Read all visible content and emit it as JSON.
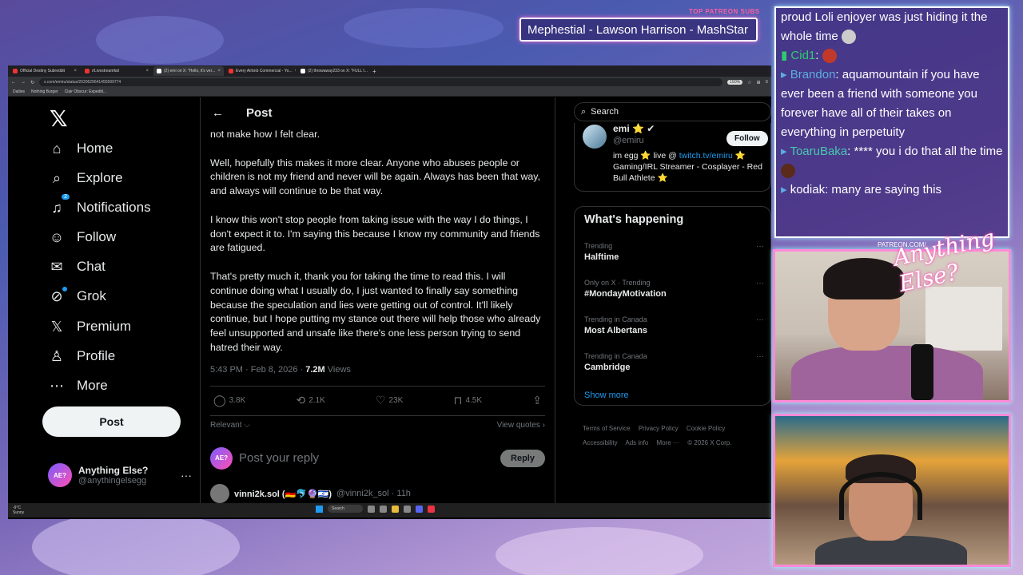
{
  "overlay": {
    "patreon_title": "TOP PATREON SUBS",
    "patreon_ticker": "Mephestial - Lawson Harrison - MashStar",
    "logo_small": "PATREON.COM/",
    "logo_script": "Anything Else?"
  },
  "browser": {
    "tabs": [
      {
        "label": "Official Destiny Subreddit",
        "close": "×"
      },
      {
        "label": "r/Livestreamfail",
        "close": "×"
      },
      {
        "label": "(2) emi on X: \"Hello, it's ver...",
        "close": "×"
      },
      {
        "label": "Every Airbnb Commercial - Yo...",
        "close": "×"
      },
      {
        "label": "(2) throwaway233 on X: \"FULL I...",
        "close": "×"
      }
    ],
    "new_tab": "+",
    "address": "x.com/emiru/status/2020629641455599774",
    "zoom": "150%",
    "bookmarks": [
      "Dailies",
      "Nothing Burger",
      "Clair Obscur: Expediti..."
    ]
  },
  "nav": {
    "logo": "𝕏",
    "items": [
      {
        "label": "Home",
        "icon": "⌂"
      },
      {
        "label": "Explore",
        "icon": "⌕"
      },
      {
        "label": "Notifications",
        "icon": "♫",
        "badge": "2"
      },
      {
        "label": "Follow",
        "icon": "☺"
      },
      {
        "label": "Chat",
        "icon": "✉"
      },
      {
        "label": "Grok",
        "icon": "⊘"
      },
      {
        "label": "Premium",
        "icon": "𝕏"
      },
      {
        "label": "Profile",
        "icon": "♙"
      },
      {
        "label": "More",
        "icon": "⋯"
      }
    ],
    "post_button": "Post",
    "account": {
      "avatar_text": "AE?",
      "name": "Anything Else?",
      "handle": "@anythingelsegg",
      "more": "···"
    }
  },
  "main": {
    "back": "←",
    "title": "Post",
    "paragraphs": [
      "not make how I felt clear.",
      "Well, hopefully this makes it more clear. Anyone who abuses people or children is not my friend and never will be again. Always has been that way, and always will continue to be that way.",
      "I know this won't stop people from taking issue with the way I do things, I don't expect it to. I'm saying this because I know my community and friends are fatigued.",
      "That's pretty much it, thank you for taking the time to read this. I will continue doing what I usually do, I just wanted to finally say something because the speculation and lies were getting out of control. It'll likely continue, but I hope putting my stance out there will help those who already feel unsupported and unsafe like there's one less person trying to send hatred their way."
    ],
    "meta_time": "5:43 PM · Feb 8, 2026 · ",
    "meta_views_count": "7.2M",
    "meta_views_label": " Views",
    "actions": [
      {
        "icon": "◯",
        "count": "3.8K"
      },
      {
        "icon": "⟲",
        "count": "2.1K"
      },
      {
        "icon": "♡",
        "count": "23K"
      },
      {
        "icon": "⊓",
        "count": "4.5K"
      },
      {
        "icon": "⇪",
        "count": ""
      }
    ],
    "relevant": "Relevant ⌵",
    "view_quotes": "View quotes ›",
    "reply_placeholder": "Post your reply",
    "reply_button": "Reply",
    "next_tweet_name": "vinni2k.sol (🇩🇪🐬🔮🇮🇱)",
    "next_tweet_handle": "@vinni2k_sol · 11h"
  },
  "right": {
    "search_placeholder": "Search",
    "who": {
      "name": "emi ⭐ ✔",
      "handle": "@emiru",
      "follow": "Follow",
      "bio_pre": "im egg ⭐ live @ ",
      "bio_link": "twitch.tv/emiru",
      "bio_post": " ⭐ Gaming/IRL Streamer - Cosplayer - Red Bull Athlete ⭐"
    },
    "happening_title": "What's happening",
    "trends": [
      {
        "context": "Trending",
        "name": "Halftime"
      },
      {
        "context": "Only on X · Trending",
        "name": "#MondayMotivation"
      },
      {
        "context": "Trending in Canada",
        "name": "Most Albertans"
      },
      {
        "context": "Trending in Canada",
        "name": "Cambridge"
      }
    ],
    "trend_more": "···",
    "show_more": "Show more",
    "footer": [
      "Terms of Service",
      "Privacy Policy",
      "Cookie Policy",
      "Accessibility",
      "Ads info",
      "More ···",
      "© 2026 X Corp."
    ]
  },
  "taskbar": {
    "weather_temp": "-9°C",
    "weather_desc": "Sunny",
    "search": "Search"
  },
  "chat": {
    "lines": [
      {
        "user": "",
        "text": "proud Loli enjoyer was just hiding it the whole time"
      },
      {
        "user": "Cid1",
        "text": ": "
      },
      {
        "user": "Brandon",
        "text": ": aquamountain if you have ever been a friend with someone you forever have all of their takes on everything in perpetuity"
      },
      {
        "user": "ToaruBaka",
        "text": ": **** you i do that all the time"
      },
      {
        "user": "kodiak",
        "text": ": many are saying this"
      }
    ]
  }
}
